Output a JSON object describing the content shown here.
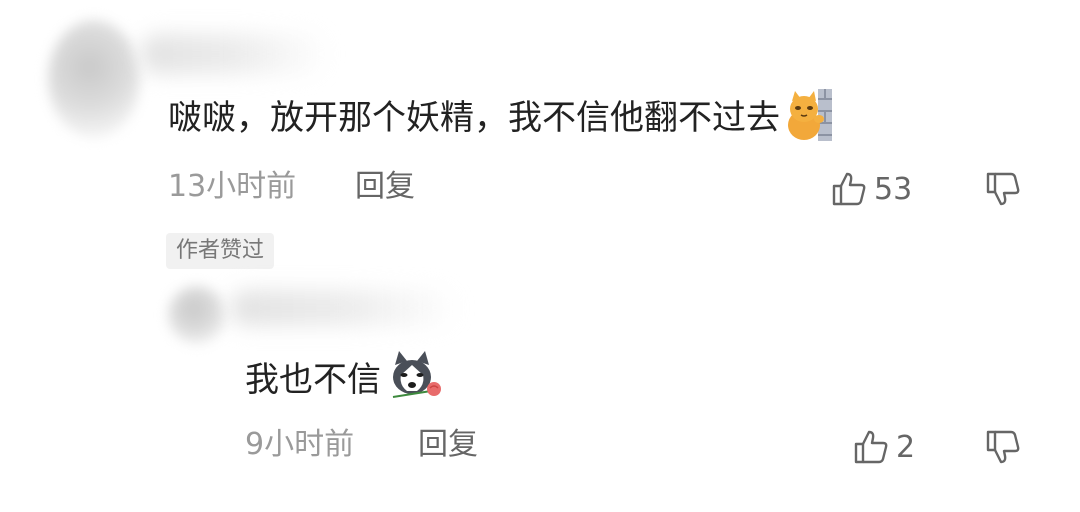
{
  "comments": [
    {
      "text": "啵啵，放开那个妖精，我不信他翻不过去",
      "emoji": "cat-wall-emoji",
      "time": "13小时前",
      "reply_label": "回复",
      "likes": "53",
      "badge": "作者赞过"
    },
    {
      "text": "我也不信",
      "emoji": "husky-rose-emoji",
      "time": "9小时前",
      "reply_label": "回复",
      "likes": "2"
    }
  ],
  "icons": {
    "like": "thumbs-up-icon",
    "dislike": "thumbs-down-icon"
  },
  "colors": {
    "text": "#222222",
    "meta": "#9a9a9a",
    "action": "#666666",
    "badge_bg": "#f1f1f1"
  }
}
